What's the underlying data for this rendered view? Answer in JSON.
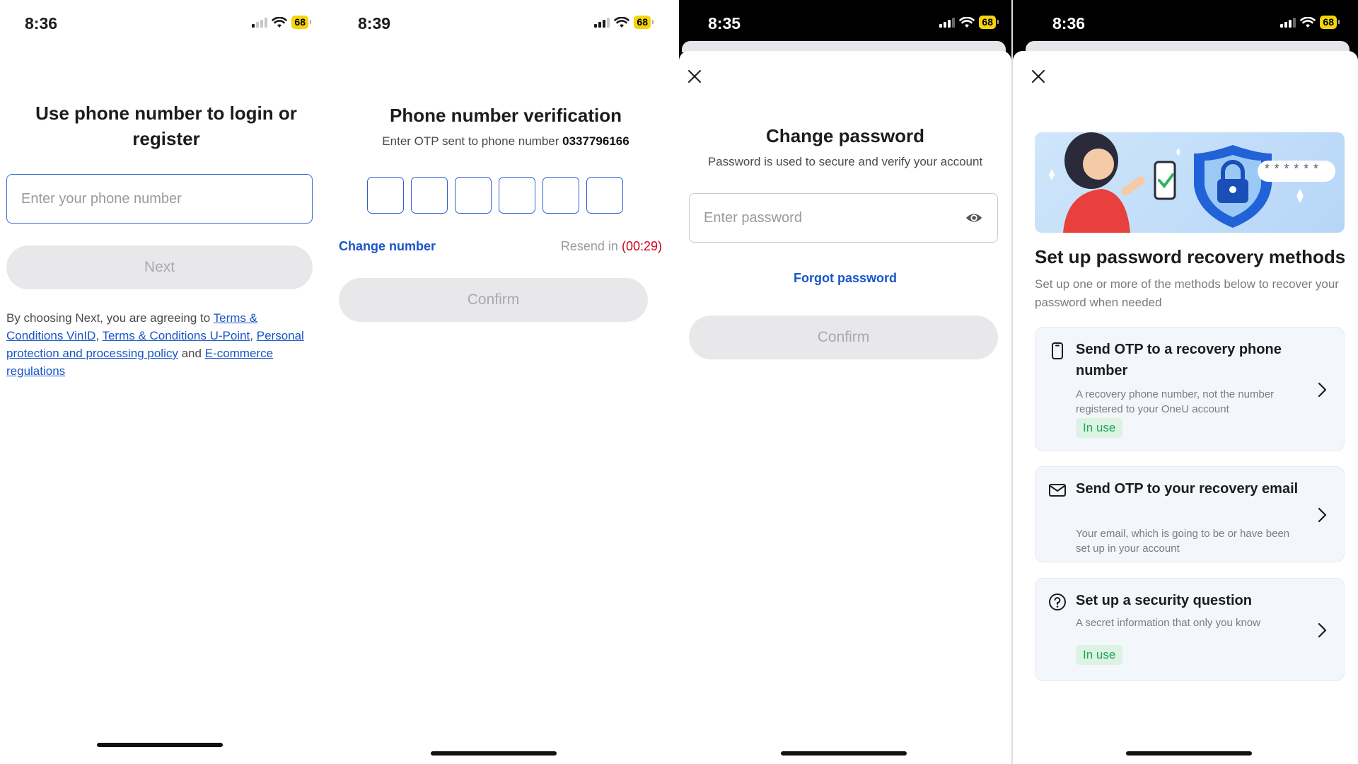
{
  "screen1": {
    "time": "8:36",
    "battery": "68",
    "title": "Use phone number to login or register",
    "phone_placeholder": "Enter your phone number",
    "next_label": "Next",
    "consent_prefix": "By choosing Next, you are agreeing to ",
    "terms_vinid": "Terms & Conditions VinID",
    "sep1": ", ",
    "terms_upoint": "Terms & Conditions U-Point",
    "sep2": ", ",
    "privacy_policy": "Personal protection and processing policy",
    "and_text": " and ",
    "ecommerce": "E-commerce regulations"
  },
  "screen2": {
    "time": "8:39",
    "battery": "68",
    "title": "Phone number verification",
    "subtitle": "Enter OTP sent to phone number ",
    "phone_number": "0337796166",
    "change_number": "Change number",
    "resend_label": "Resend in ",
    "countdown": "(00:29)",
    "confirm_label": "Confirm"
  },
  "screen3": {
    "time": "8:35",
    "battery": "68",
    "title": "Change password",
    "subtitle": "Password is used to secure and verify your account",
    "password_placeholder": "Enter password",
    "forgot_password": "Forgot password",
    "confirm_label": "Confirm"
  },
  "screen4": {
    "time": "8:36",
    "battery": "68",
    "banner_password_mask": "******",
    "title": "Set up password recovery methods",
    "subtitle": "Set up one or more of the methods below to recover your password when needed",
    "methods": [
      {
        "title": "Send OTP to a recovery phone number",
        "description": "A recovery phone number, not the number registered to your OneU account",
        "badge": "In use",
        "icon": "phone-icon"
      },
      {
        "title": "Send OTP to your recovery email",
        "description": "Your email, which is going to be or have been set up in your account",
        "badge": "",
        "icon": "mail-icon"
      },
      {
        "title": "Set up a security question",
        "description": "A secret information that only you know",
        "badge": "In use",
        "icon": "question-icon"
      }
    ]
  },
  "colors": {
    "accent": "#1a55c7",
    "countdown": "#d0021b",
    "badge_bg": "#dcf3e4",
    "badge_text": "#1ea35a",
    "battery": "#f5d40c"
  }
}
